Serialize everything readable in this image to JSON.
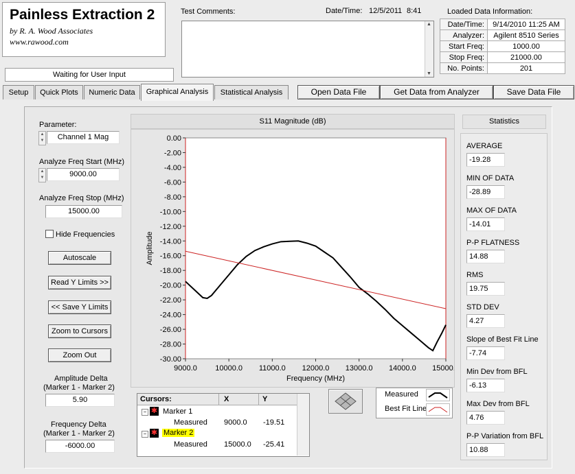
{
  "app": {
    "title": "Painless Extraction 2",
    "byline": "by R. A. Wood Associates",
    "url": "www.rawood.com",
    "status": "Waiting for User Input"
  },
  "header": {
    "test_comments_label": "Test Comments:",
    "datetime_label": "Date/Time:",
    "date_value": "12/5/2011",
    "time_value": "8:41",
    "loaded_label": "Loaded Data Information:"
  },
  "loaded_info": [
    {
      "label": "Date/Time:",
      "value": "9/14/2010 11:25 AM"
    },
    {
      "label": "Analyzer:",
      "value": "Agilent 8510 Series"
    },
    {
      "label": "Start Freq:",
      "value": "1000.00"
    },
    {
      "label": "Stop Freq:",
      "value": "21000.00"
    },
    {
      "label": "No. Points:",
      "value": "201"
    }
  ],
  "tabs": [
    "Setup",
    "Quick Plots",
    "Numeric Data",
    "Graphical Analysis",
    "Statistical Analysis"
  ],
  "toolbar": {
    "open": "Open Data File",
    "get": "Get Data from Analyzer",
    "save": "Save Data File"
  },
  "left": {
    "parameter_label": "Parameter:",
    "parameter_value": "Channel 1 Mag",
    "freq_start_label": "Analyze Freq Start (MHz)",
    "freq_start_value": "9000.00",
    "freq_stop_label": "Analyze Freq Stop (MHz)",
    "freq_stop_value": "15000.00",
    "hide_freq_label": "Hide Frequencies",
    "autoscale": "Autoscale",
    "read_y": "Read Y Limits >>",
    "save_y": "<< Save Y Limits",
    "zoom_cursors": "Zoom to Cursors",
    "zoom_out": "Zoom Out",
    "amp_delta_label1": "Amplitude Delta",
    "amp_delta_label2": "(Marker 1 - Marker 2)",
    "amp_delta_value": "5.90",
    "freq_delta_label1": "Frequency Delta",
    "freq_delta_label2": "(Marker 1 - Marker 2)",
    "freq_delta_value": "-6000.00"
  },
  "cursors": {
    "header": "Cursors:",
    "col_x": "X",
    "col_y": "Y",
    "marker1": "Marker 1",
    "marker2": "Marker 2",
    "measured": "Measured",
    "m1_x": "9000.0",
    "m1_y": "-19.51",
    "m2_x": "15000.0",
    "m2_y": "-25.41"
  },
  "legend": {
    "measured": "Measured",
    "best_fit": "Best Fit Line"
  },
  "statistics": {
    "title": "Statistics",
    "items": [
      {
        "label": "AVERAGE",
        "value": "-19.28"
      },
      {
        "label": "MIN OF DATA",
        "value": "-28.89"
      },
      {
        "label": "MAX OF DATA",
        "value": "-14.01"
      },
      {
        "label": "P-P FLATNESS",
        "value": "14.88"
      },
      {
        "label": "RMS",
        "value": "19.75"
      },
      {
        "label": "STD DEV",
        "value": "4.27"
      },
      {
        "label": "Slope of Best Fit Line",
        "value": "-7.74"
      },
      {
        "label": "Min Dev from BFL",
        "value": "-6.13"
      },
      {
        "label": "Max Dev from BFL",
        "value": "4.76"
      },
      {
        "label": "P-P Variation from BFL",
        "value": "10.88"
      }
    ]
  },
  "colors": {
    "measured": "#000000",
    "best_fit": "#cc2222",
    "plot_bg": "#ffffff",
    "marker2_highlight": "#ffff00"
  },
  "chart_data": {
    "type": "line",
    "title": "S11 Magnitude (dB)",
    "xlabel": "Frequency (MHz)",
    "ylabel": "Amplitude",
    "xlim": [
      9000,
      15000
    ],
    "ylim": [
      -30,
      0
    ],
    "x_ticks": [
      "9000.0",
      "10000.0",
      "11000.0",
      "12000.0",
      "13000.0",
      "14000.0",
      "15000.0"
    ],
    "y_ticks": [
      "0.00",
      "-2.00",
      "-4.00",
      "-6.00",
      "-8.00",
      "-10.00",
      "-12.00",
      "-14.00",
      "-16.00",
      "-18.00",
      "-20.00",
      "-22.00",
      "-24.00",
      "-26.00",
      "-28.00",
      "-30.00"
    ],
    "grid": false,
    "series": [
      {
        "name": "Measured",
        "x": [
          9000,
          9200,
          9400,
          9500,
          9600,
          9800,
          10000,
          10200,
          10400,
          10600,
          10800,
          11000,
          11200,
          11400,
          11600,
          11800,
          12000,
          12200,
          12400,
          12600,
          12800,
          13000,
          13200,
          13400,
          13600,
          13800,
          14000,
          14200,
          14400,
          14600,
          14700,
          14800,
          14900,
          15000
        ],
        "y": [
          -19.5,
          -20.6,
          -21.7,
          -21.8,
          -21.4,
          -20.0,
          -18.6,
          -17.2,
          -16.1,
          -15.3,
          -14.8,
          -14.4,
          -14.1,
          -14.05,
          -14.0,
          -14.3,
          -14.7,
          -15.5,
          -16.3,
          -17.6,
          -18.9,
          -20.3,
          -21.2,
          -22.2,
          -23.3,
          -24.5,
          -25.5,
          -26.5,
          -27.5,
          -28.5,
          -28.9,
          -27.7,
          -26.6,
          -25.4
        ]
      },
      {
        "name": "Best Fit Line",
        "x": [
          9000,
          15000
        ],
        "y": [
          -15.4,
          -23.2
        ]
      }
    ]
  }
}
